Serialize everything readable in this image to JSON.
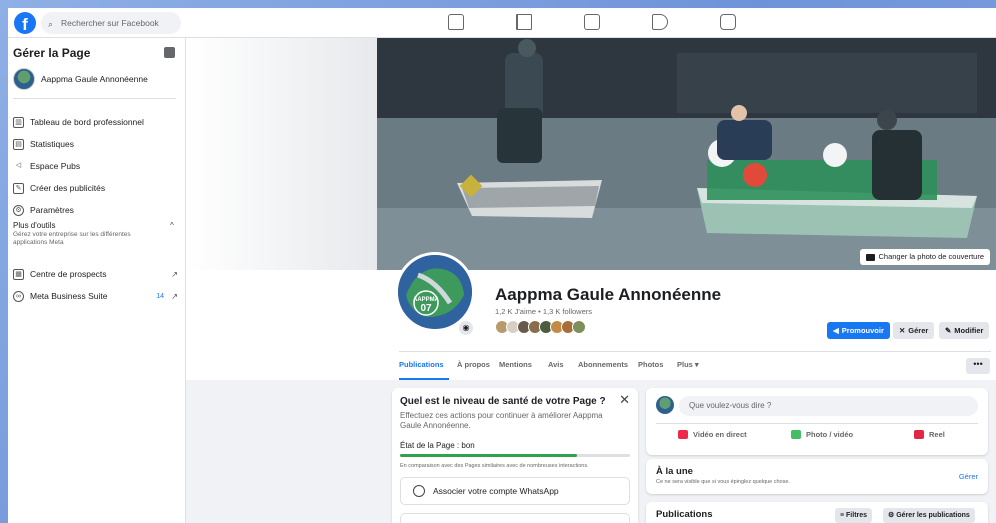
{
  "topbar": {
    "logo": "f",
    "search_placeholder": "Rechercher sur Facebook",
    "nav_icons": [
      "home-icon",
      "flag-icon",
      "video-store-icon",
      "megaphone-icon",
      "play-icon"
    ]
  },
  "sidebar": {
    "title": "Gérer la Page",
    "page_name": "Aappma Gaule Annonéenne",
    "items": [
      {
        "label": "Tableau de bord professionnel",
        "icon": "dashboard-icon"
      },
      {
        "label": "Statistiques",
        "icon": "stats-icon"
      },
      {
        "label": "Espace Pubs",
        "icon": "megaphone-icon"
      },
      {
        "label": "Créer des publicités",
        "icon": "edit-icon"
      },
      {
        "label": "Paramètres",
        "icon": "gear-icon"
      }
    ],
    "more_tools": {
      "title": "Plus d'outils",
      "description": "Gérez votre entreprise sur les différentes applications Meta"
    },
    "tool_items": [
      {
        "label": "Centre de prospects",
        "icon": "leads-icon",
        "arrow": "↗"
      },
      {
        "label": "Meta Business Suite",
        "icon": "meta-icon",
        "badge": "14",
        "arrow": "↗"
      }
    ]
  },
  "cover": {
    "change_button": "Changer la photo de couverture"
  },
  "profile": {
    "name": "Aappma Gaule Annonéenne",
    "stats": "1,2 K J'aime • 1,3 K followers",
    "badge_text": "AAPPMA 07",
    "buttons": {
      "promote": "Promouvoir",
      "manage": "Gérer",
      "edit": "Modifier"
    }
  },
  "tabs": [
    "Publications",
    "À propos",
    "Mentions",
    "Avis",
    "Abonnements",
    "Photos",
    "Plus ▾"
  ],
  "tabs_more": "•••",
  "health": {
    "title": "Quel est le niveau de santé de votre Page ?",
    "description": "Effectuez ces actions pour continuer à améliorer Aappma Gaule Annonéenne.",
    "state": "État de la Page : bon",
    "progress": 0.77,
    "compare": "En comparaison avec des Pages similaires avec de nombreuses interactions.",
    "whatsapp_button": "Associer votre compte WhatsApp"
  },
  "composer": {
    "placeholder": "Que voulez-vous dire ?",
    "options": [
      "Vidéo en direct",
      "Photo / vidéo",
      "Reel"
    ]
  },
  "featured": {
    "title": "À la une",
    "description": "Ce ne sera visible que si vous épinglez quelque chose.",
    "link": "Gérer"
  },
  "posts": {
    "title": "Publications",
    "filters": "Filtres",
    "manage": "Gérer les publications"
  },
  "colors": {
    "brand": "#1877f2",
    "health_green": "#31a24c",
    "live_red": "#f02849",
    "photo_green": "#45bd62",
    "reel_red": "#e42645"
  }
}
